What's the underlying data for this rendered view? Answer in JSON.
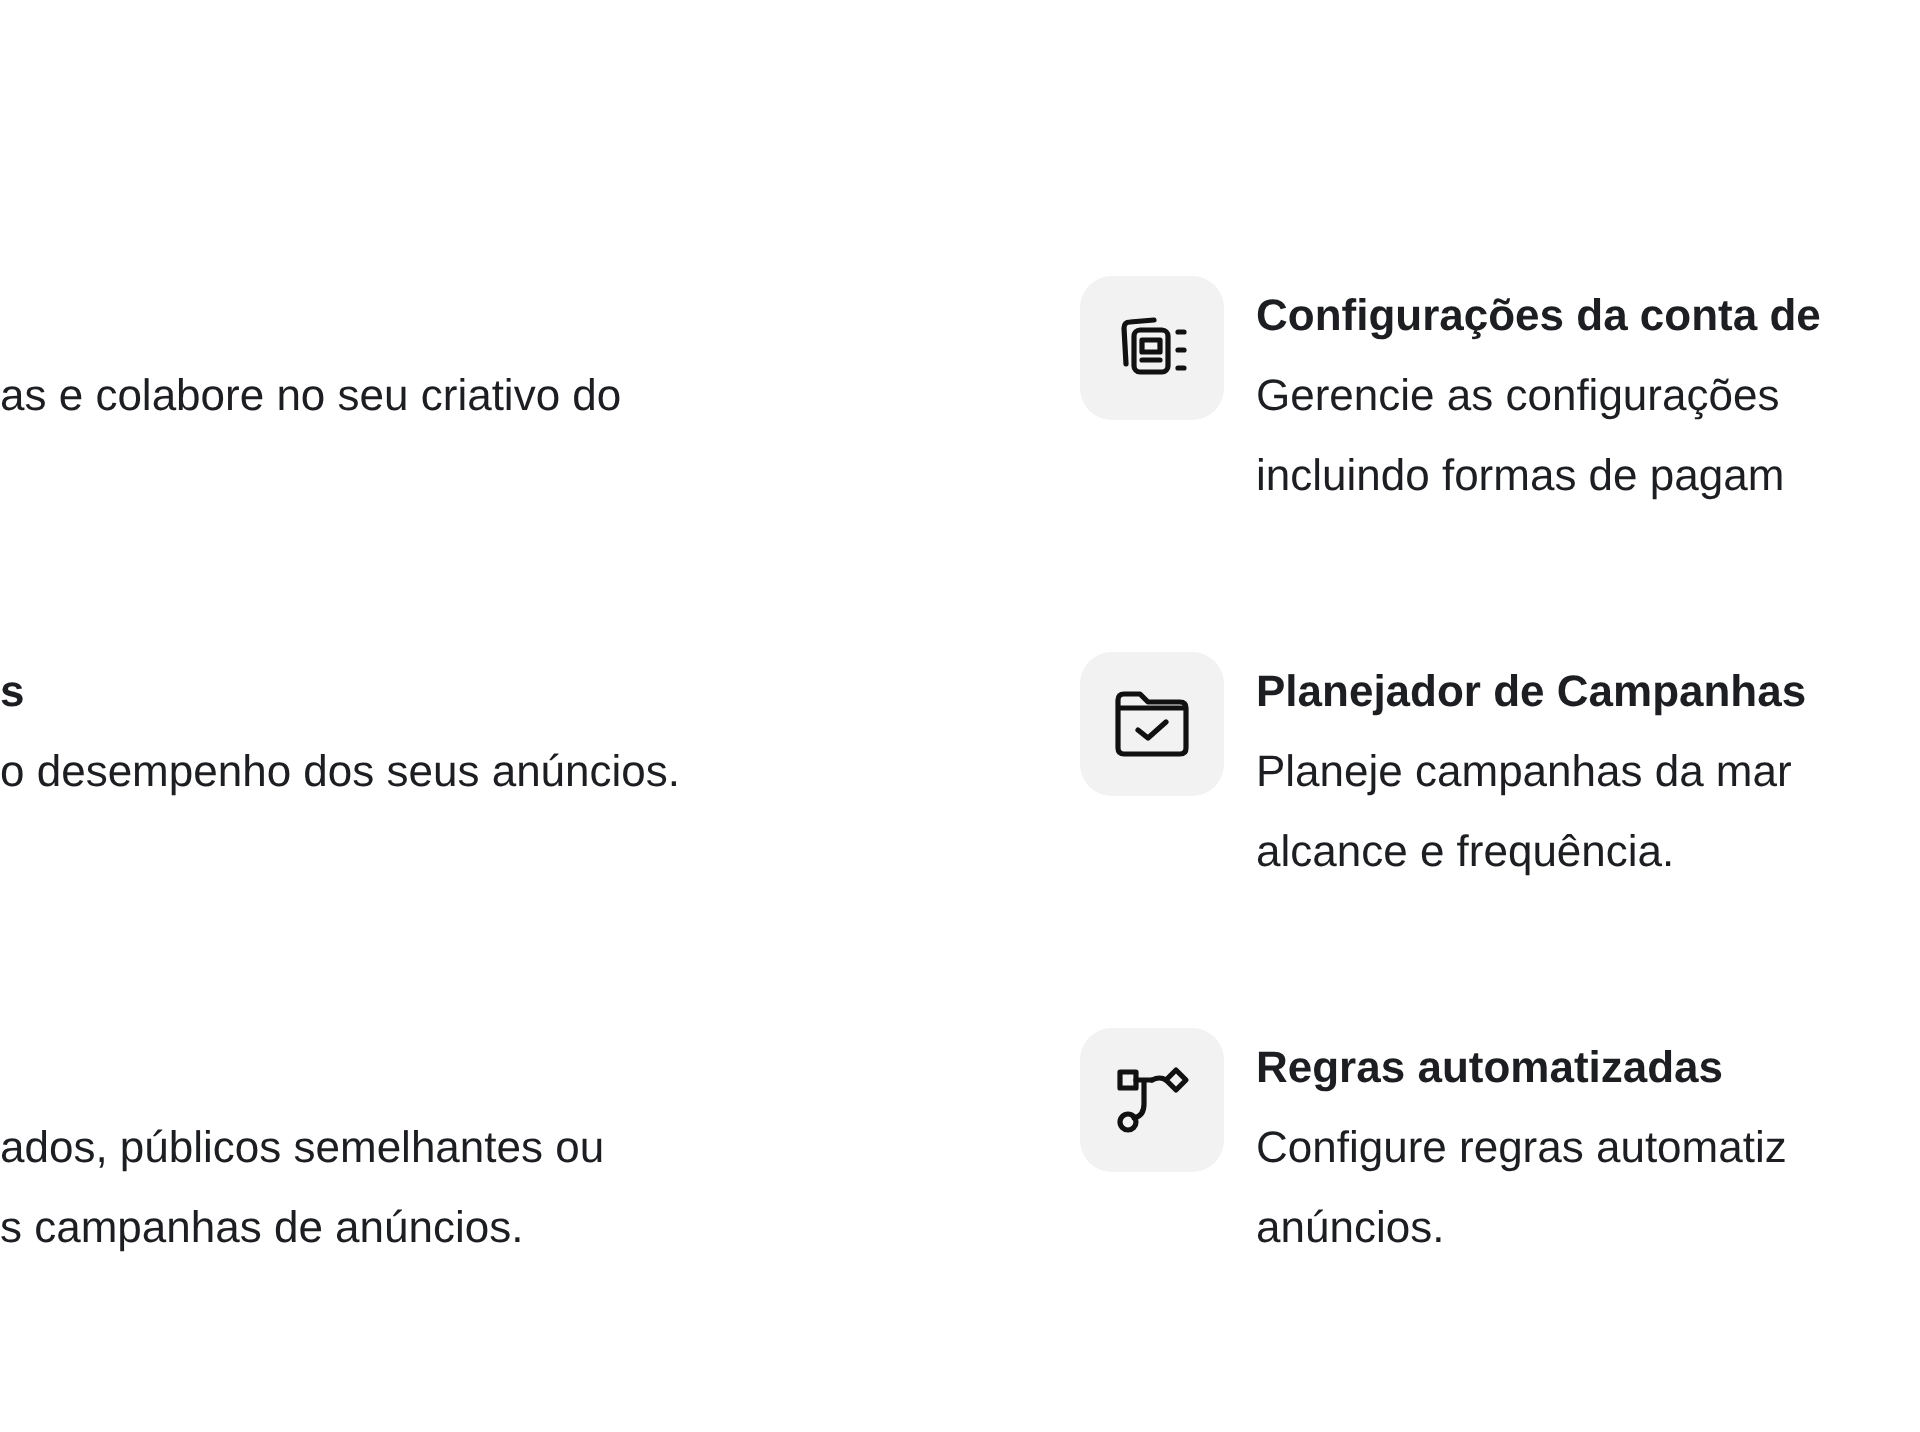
{
  "left_items": [
    {
      "description": [
        "as e colabore no seu criativo do"
      ]
    },
    {
      "title": "s",
      "description": [
        "o desempenho dos seus anúncios."
      ]
    },
    {
      "description": [
        "ados, públicos semelhantes ou",
        "s campanhas de anúncios."
      ]
    }
  ],
  "right_items": [
    {
      "kind": "settings",
      "title": "Configurações da conta de",
      "description": [
        "Gerencie as configurações",
        "incluindo formas de pagam"
      ]
    },
    {
      "kind": "planner",
      "title": "Planejador de Campanhas",
      "description": [
        "Planeje campanhas da mar",
        "alcance e frequência."
      ]
    },
    {
      "kind": "rules",
      "title": "Regras automatizadas",
      "description": [
        "Configure regras automatiz",
        "anúncios."
      ]
    }
  ]
}
